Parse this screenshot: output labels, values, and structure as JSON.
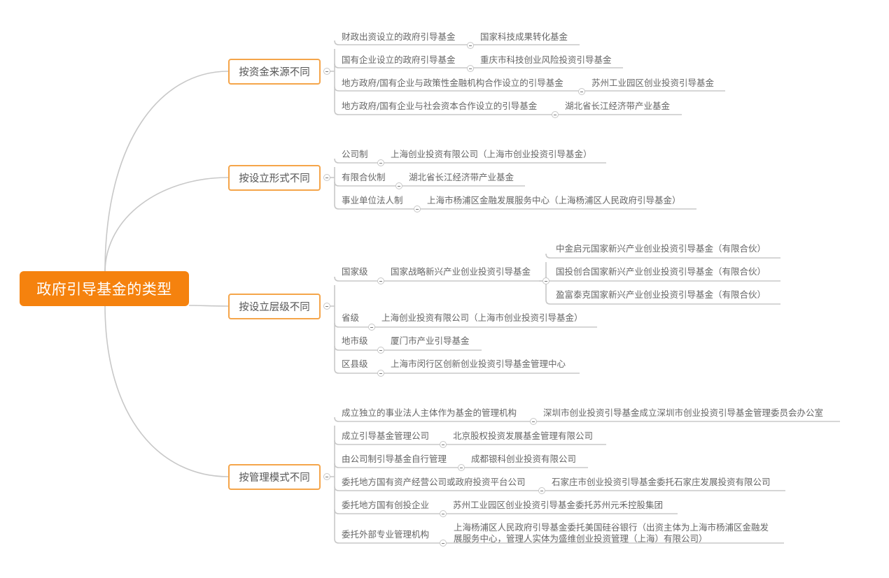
{
  "root": {
    "label": "政府引导基金的类型"
  },
  "categories": [
    {
      "label": "按资金来源不同",
      "items": [
        {
          "label": "财政出资设立的政府引导基金",
          "examples": [
            "国家科技成果转化基金"
          ]
        },
        {
          "label": "国有企业设立的政府引导基金",
          "examples": [
            "重庆市科技创业风险投资引导基金"
          ]
        },
        {
          "label": "地方政府/国有企业与政策性金融机构合作设立的引导基金",
          "examples": [
            "苏州工业园区创业投资引导基金"
          ]
        },
        {
          "label": "地方政府/国有企业与社会资本合作设立的引导基金",
          "examples": [
            "湖北省长江经济带产业基金"
          ]
        }
      ]
    },
    {
      "label": "按设立形式不同",
      "items": [
        {
          "label": "公司制",
          "examples": [
            "上海创业投资有限公司（上海市创业投资引导基金）"
          ]
        },
        {
          "label": "有限合伙制",
          "examples": [
            "湖北省长江经济带产业基金"
          ]
        },
        {
          "label": "事业单位法人制",
          "examples": [
            "上海市杨浦区金融发展服务中心（上海杨浦区人民政府引导基金）"
          ]
        }
      ]
    },
    {
      "label": "按设立层级不同",
      "items": [
        {
          "label": "国家级",
          "examples": [
            "国家战略新兴产业创业投资引导基金"
          ],
          "sub": [
            "中金启元国家新兴产业创业投资引导基金（有限合伙）",
            "国投创合国家新兴产业创业投资引导基金（有限合伙）",
            "盈富泰克国家新兴产业创业投资引导基金（有限合伙）"
          ]
        },
        {
          "label": "省级",
          "examples": [
            "上海创业投资有限公司（上海市创业投资引导基金）"
          ]
        },
        {
          "label": "地市级",
          "examples": [
            "厦门市产业引导基金"
          ]
        },
        {
          "label": "区县级",
          "examples": [
            "上海市闵行区创新创业投资引导基金管理中心"
          ]
        }
      ]
    },
    {
      "label": "按管理模式不同",
      "items": [
        {
          "label": "成立独立的事业法人主体作为基金的管理机构",
          "examples": [
            "深圳市创业投资引导基金成立深圳市创业投资引导基金管理委员会办公室"
          ]
        },
        {
          "label": "成立引导基金管理公司",
          "examples": [
            "北京股权投资发展基金管理有限公司"
          ]
        },
        {
          "label": "由公司制引导基金自行管理",
          "examples": [
            "成都银科创业投资有限公司"
          ]
        },
        {
          "label": "委托地方国有资产经营公司或政府投资平台公司",
          "examples": [
            "石家庄市创业投资引导基金委托石家庄发展投资有限公司"
          ]
        },
        {
          "label": "委托地方国有创投企业",
          "examples": [
            "苏州工业园区创业投资引导基金委托苏州元禾控股集团"
          ]
        },
        {
          "label": "委托外部专业管理机构",
          "examples": [
            "上海杨浦区人民政府引导基金委托美国硅谷银行（出资主体为上海市杨浦区金融发展服务中心，管理人实体为盛维创业投资管理（上海）有限公司）"
          ]
        }
      ]
    }
  ]
}
